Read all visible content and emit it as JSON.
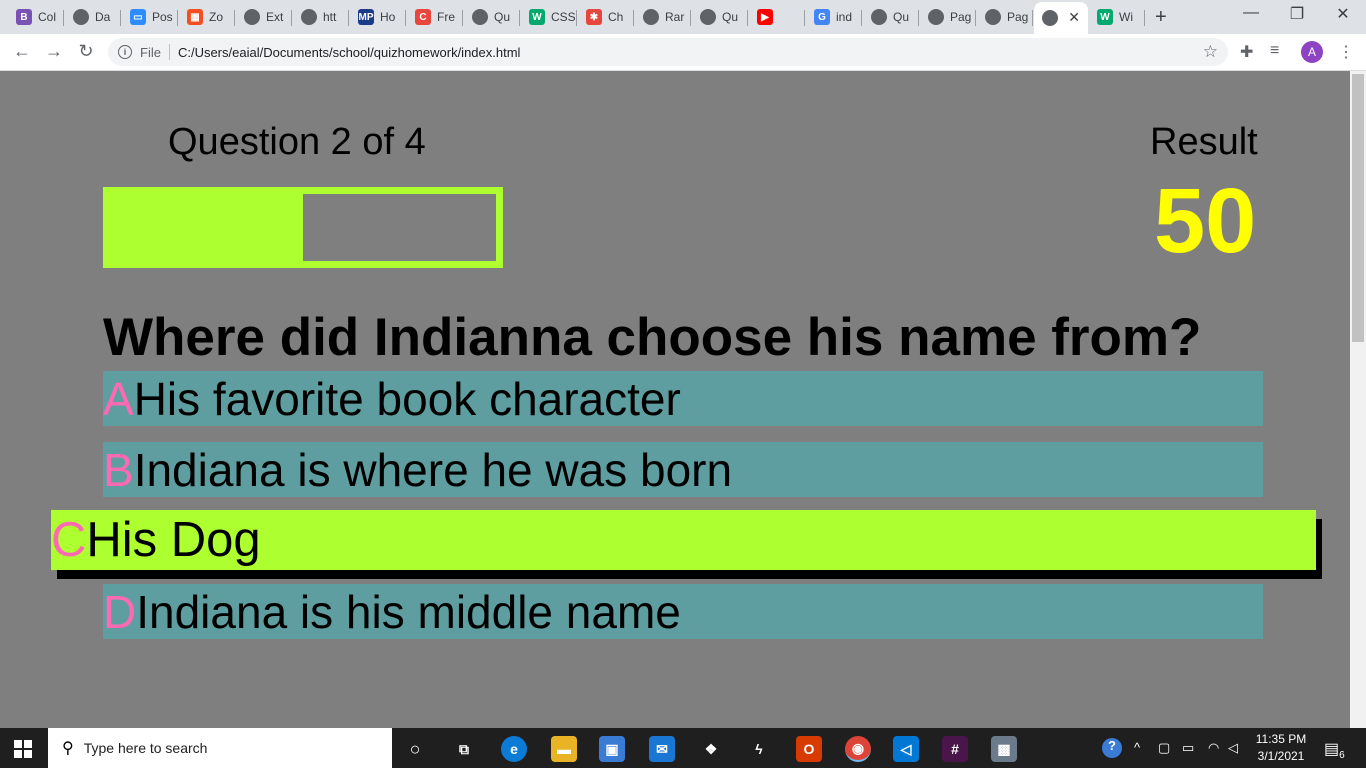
{
  "browser": {
    "tabs": [
      {
        "label": "Col",
        "icon": "bootstrap-icon",
        "color": "#7952b3",
        "glyph": "B"
      },
      {
        "label": "Da",
        "icon": "globe-icon",
        "color": "#5f6368",
        "glyph": ""
      },
      {
        "label": "Pos",
        "icon": "zoom-icon",
        "color": "#2d8cff",
        "glyph": "▭"
      },
      {
        "label": "Zo",
        "icon": "microsoft-icon",
        "color": "#f25022",
        "glyph": "▦"
      },
      {
        "label": "Ext",
        "icon": "globe-icon",
        "color": "#5f6368",
        "glyph": ""
      },
      {
        "label": "htt",
        "icon": "globe-icon",
        "color": "#5f6368",
        "glyph": ""
      },
      {
        "label": "Ho",
        "icon": "mp-icon",
        "color": "#1a3a8a",
        "glyph": "MP"
      },
      {
        "label": "Fre",
        "icon": "c-icon",
        "color": "#e8453c",
        "glyph": "C"
      },
      {
        "label": "Qu",
        "icon": "globe-icon",
        "color": "#5f6368",
        "glyph": ""
      },
      {
        "label": "CSS",
        "icon": "w3schools-icon",
        "color": "#04aa6d",
        "glyph": "W"
      },
      {
        "label": "Ch",
        "icon": "asterisk-icon",
        "color": "#e8453c",
        "glyph": "✱"
      },
      {
        "label": "Rar",
        "icon": "globe-icon",
        "color": "#5f6368",
        "glyph": ""
      },
      {
        "label": "Qu",
        "icon": "globe-icon",
        "color": "#5f6368",
        "glyph": ""
      },
      {
        "label": "",
        "icon": "youtube-icon",
        "color": "#ff0000",
        "glyph": "▶"
      },
      {
        "label": "ind",
        "icon": "google-icon",
        "color": "#4285f4",
        "glyph": "G"
      },
      {
        "label": "Qu",
        "icon": "globe-icon",
        "color": "#5f6368",
        "glyph": ""
      },
      {
        "label": "Pag",
        "icon": "globe-icon",
        "color": "#5f6368",
        "glyph": ""
      },
      {
        "label": "Pag",
        "icon": "globe-icon",
        "color": "#5f6368",
        "glyph": ""
      },
      {
        "label": "",
        "icon": "globe-icon",
        "color": "#5f6368",
        "glyph": "",
        "active": true
      },
      {
        "label": "Wi",
        "icon": "w3schools-icon",
        "color": "#04aa6d",
        "glyph": "W"
      }
    ],
    "address": {
      "scheme_label": "File",
      "url": "C:/Users/eaial/Documents/school/quizhomework/index.html"
    },
    "profile_initial": "A"
  },
  "quiz": {
    "progress_text": "Question 2 of 4",
    "progress_fraction": 0.5,
    "result_label": "Result",
    "score": "50",
    "question": "Where did Indianna choose his name from?",
    "choices": [
      {
        "letter": "A",
        "text": "His favorite book character",
        "selected": false
      },
      {
        "letter": "B",
        "text": "Indiana is where he was born",
        "selected": false
      },
      {
        "letter": "C",
        "text": "His Dog",
        "selected": true
      },
      {
        "letter": "D",
        "text": "Indiana is his middle name",
        "selected": false
      }
    ],
    "colors": {
      "background": "#7f7f7f",
      "accent": "#adff2f",
      "score": "#ffff00",
      "choice": "#5f9ea0",
      "letter": "#ff69b4"
    }
  },
  "taskbar": {
    "search_placeholder": "Type here to search",
    "time": "11:35 PM",
    "date": "3/1/2021",
    "notification_count": "6"
  }
}
